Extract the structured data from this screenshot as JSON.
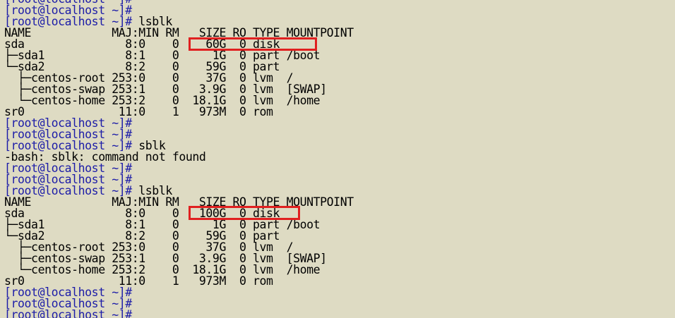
{
  "terminal": {
    "lines": [
      {
        "type": "prompt",
        "prompt": "[root@localhost ~]#",
        "command": ""
      },
      {
        "type": "prompt",
        "prompt": "[root@localhost ~]#",
        "command": ""
      },
      {
        "type": "prompt",
        "prompt": "[root@localhost ~]#",
        "command": " lsblk"
      },
      {
        "type": "output",
        "text": "NAME            MAJ:MIN RM   SIZE RO TYPE MOUNTPOINT"
      },
      {
        "type": "output",
        "text": "sda               8:0    0    60G  0 disk"
      },
      {
        "type": "output",
        "text": "├─sda1            8:1    0     1G  0 part /boot"
      },
      {
        "type": "output",
        "text": "└─sda2            8:2    0    59G  0 part"
      },
      {
        "type": "output",
        "text": "  ├─centos-root 253:0    0    37G  0 lvm  /"
      },
      {
        "type": "output",
        "text": "  ├─centos-swap 253:1    0   3.9G  0 lvm  [SWAP]"
      },
      {
        "type": "output",
        "text": "  └─centos-home 253:2    0  18.1G  0 lvm  /home"
      },
      {
        "type": "output",
        "text": "sr0              11:0    1   973M  0 rom"
      },
      {
        "type": "prompt",
        "prompt": "[root@localhost ~]#",
        "command": ""
      },
      {
        "type": "prompt",
        "prompt": "[root@localhost ~]#",
        "command": ""
      },
      {
        "type": "prompt",
        "prompt": "[root@localhost ~]#",
        "command": " sblk"
      },
      {
        "type": "output",
        "text": "-bash: sblk: command not found"
      },
      {
        "type": "prompt",
        "prompt": "[root@localhost ~]#",
        "command": ""
      },
      {
        "type": "prompt",
        "prompt": "[root@localhost ~]#",
        "command": ""
      },
      {
        "type": "prompt",
        "prompt": "[root@localhost ~]#",
        "command": " lsblk"
      },
      {
        "type": "output",
        "text": "NAME            MAJ:MIN RM   SIZE RO TYPE MOUNTPOINT"
      },
      {
        "type": "output",
        "text": "sda               8:0    0   100G  0 disk"
      },
      {
        "type": "output",
        "text": "├─sda1            8:1    0     1G  0 part /boot"
      },
      {
        "type": "output",
        "text": "└─sda2            8:2    0    59G  0 part"
      },
      {
        "type": "output",
        "text": "  ├─centos-root 253:0    0    37G  0 lvm  /"
      },
      {
        "type": "output",
        "text": "  ├─centos-swap 253:1    0   3.9G  0 lvm  [SWAP]"
      },
      {
        "type": "output",
        "text": "  └─centos-home 253:2    0  18.1G  0 lvm  /home"
      },
      {
        "type": "output",
        "text": "sr0              11:0    1   973M  0 rom"
      },
      {
        "type": "prompt",
        "prompt": "[root@localhost ~]#",
        "command": ""
      },
      {
        "type": "prompt",
        "prompt": "[root@localhost ~]#",
        "command": ""
      },
      {
        "type": "prompt",
        "prompt": "[root@localhost ~]#",
        "command": ""
      }
    ],
    "colors": {
      "background": "#dedbc3",
      "prompt": "#1c1ca8",
      "text": "#000000",
      "highlight_box": "#e02020"
    }
  }
}
